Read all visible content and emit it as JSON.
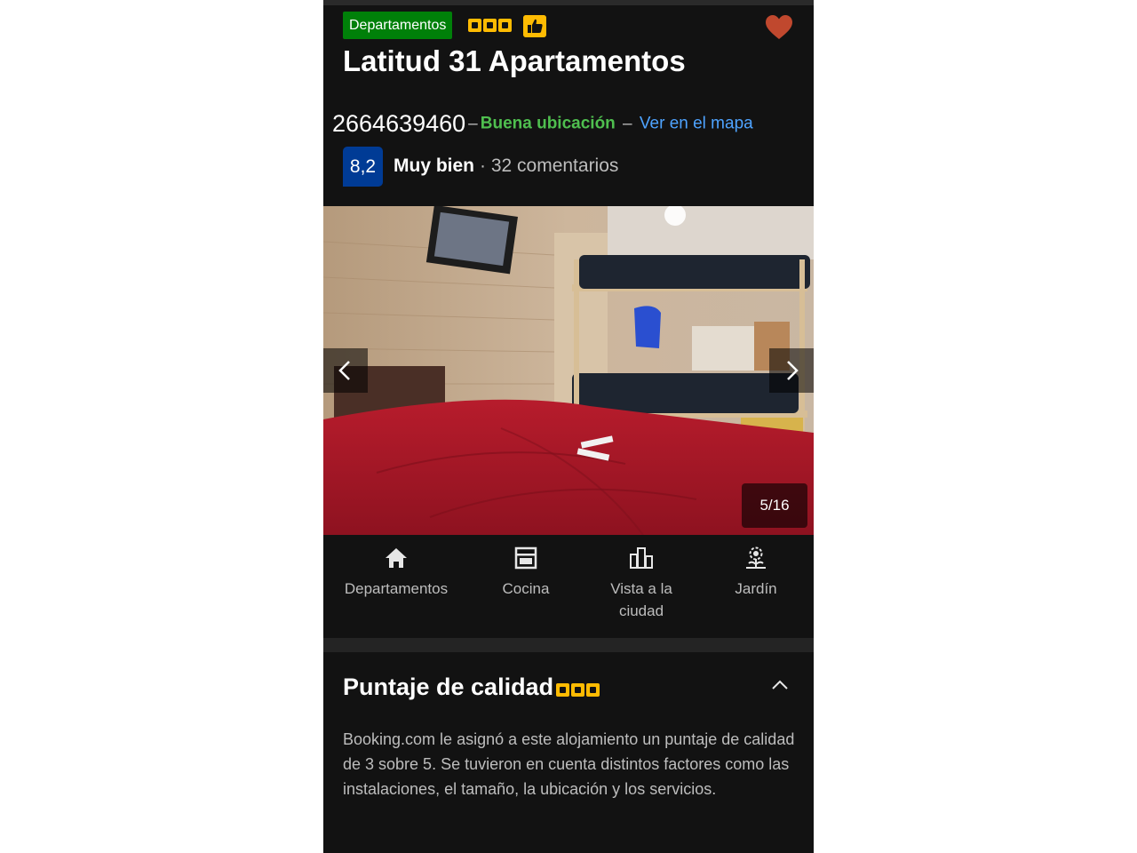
{
  "property": {
    "type_badge": "Departamentos",
    "quality_stars": 3,
    "title": "Latitud 31 Apartamentos",
    "phone": "2664639460",
    "location_label": "Buena ubicación",
    "map_link": "Ver en el mapa",
    "score": "8,2",
    "score_word": "Muy bien",
    "reviews": "· 32 comentarios"
  },
  "gallery": {
    "counter": "5/16"
  },
  "facilities": [
    {
      "label": "Departamentos",
      "icon": "house-icon"
    },
    {
      "label": "Cocina",
      "icon": "oven-icon"
    },
    {
      "label": "Vista a la ciudad",
      "icon": "city-icon"
    },
    {
      "label": "Jardín",
      "icon": "flower-icon"
    }
  ],
  "quality_section": {
    "title": "Puntaje de calidad",
    "body": "Booking.com le asignó a este alojamiento un puntaje de calidad de 3 sobre 5. Se tuvieron en cuenta distintos factores como las instalaciones, el tamaño, la ubicación y los servicios."
  },
  "colors": {
    "background": "#121212",
    "badge_green": "#008009",
    "star_yellow": "#febb02",
    "score_blue": "#003b95",
    "location_green": "#4fbf4f",
    "link_blue": "#4ea3ff",
    "heart": "#c0482e"
  }
}
